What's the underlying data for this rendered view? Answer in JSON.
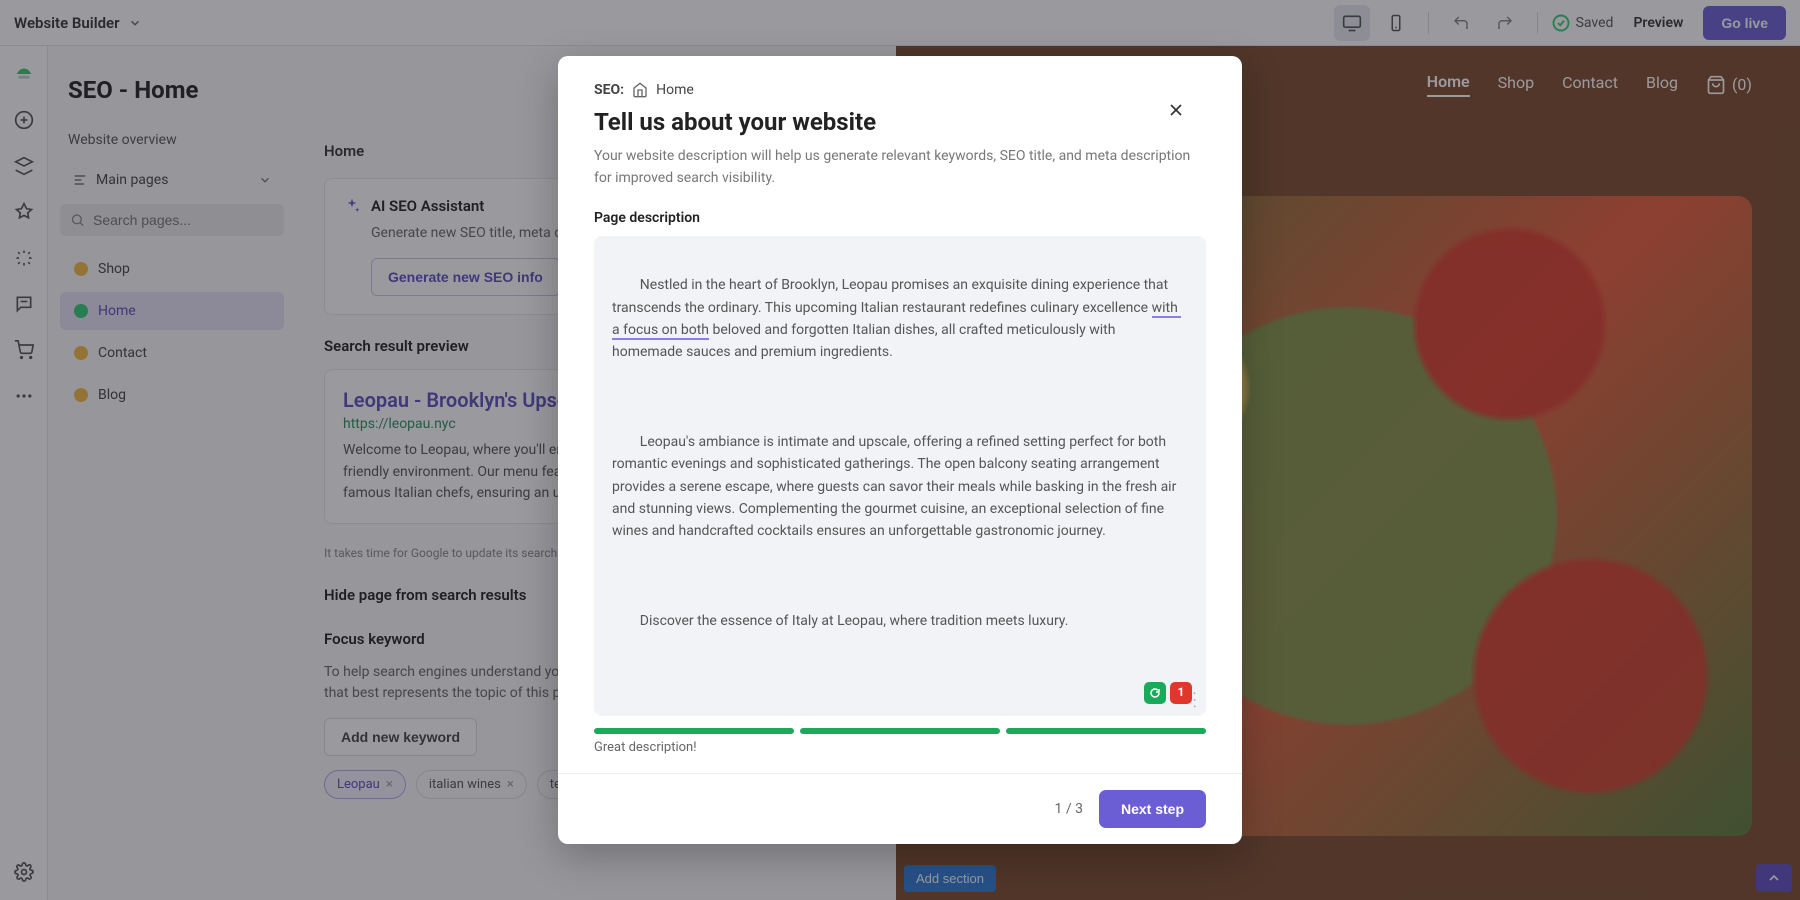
{
  "topbar": {
    "app_name": "Website Builder",
    "saved_label": "Saved",
    "preview_label": "Preview",
    "golive_label": "Go live"
  },
  "panel": {
    "title": "SEO - Home",
    "overview_label": "Website overview",
    "main_pages_label": "Main pages",
    "search_placeholder": "Search pages...",
    "pages": [
      {
        "label": "Shop",
        "status": "yellow"
      },
      {
        "label": "Home",
        "status": "green"
      },
      {
        "label": "Contact",
        "status": "yellow"
      },
      {
        "label": "Blog",
        "status": "yellow"
      }
    ],
    "content": {
      "breadcrumb": "Home",
      "ai_title": "AI SEO Assistant",
      "ai_desc": "Generate new SEO title, meta description and focus keywords for this page",
      "generate_label": "Generate new SEO info",
      "serp_section": "Search result preview",
      "serp_title": "Leopau - Brooklyn's Upscale Italian Restaurant",
      "serp_url": "https://leopau.nyc",
      "serp_desc": "Welcome to Leopau, where you'll enjoy authentic Italian cuisine in a warm and friendly environment. Our menu features traditional dishes and recipes from famous Italian chefs, ensuring an unforgettable culinary experience like no other.",
      "serp_hint": "It takes time for Google to update its search results",
      "hide_section": "Hide page from search results",
      "focus_section": "Focus keyword",
      "focus_help": "To help search engines understand your page content, enter a keyword or keyphrase that best represents the topic of this page",
      "add_keyword_label": "Add new keyword",
      "keywords": [
        {
          "label": "Leopau",
          "primary": true
        },
        {
          "label": "italian wines",
          "primary": false
        },
        {
          "label": "terrace dining",
          "primary": false
        }
      ]
    }
  },
  "site": {
    "nav": [
      "Home",
      "Shop",
      "Contact",
      "Blog"
    ],
    "cart_count": "(0)",
    "add_section": "Add section"
  },
  "modal": {
    "crumb_prefix": "SEO:",
    "crumb_page": "Home",
    "title": "Tell us about your website",
    "subtitle": "Your website description will help us generate relevant keywords, SEO title, and meta description for improved search visibility.",
    "field_label": "Page description",
    "description_p1a": "Nestled in the heart of Brooklyn, Leopau promises an exquisite dining experience that transcends the ordinary. This upcoming Italian restaurant redefines culinary excellence ",
    "description_underlined": "with a focus on both",
    "description_p1b": " beloved and forgotten Italian dishes, all crafted meticulously with homemade sauces and premium ingredients.",
    "description_p2": "Leopau's ambiance is intimate and upscale, offering a refined setting perfect for both romantic evenings and sophisticated gatherings. The open balcony seating arrangement provides a serene escape, where guests can savor their meals while basking in the fresh air and stunning views. Complementing the gourmet cuisine, an exceptional selection of fine wines and handcrafted cocktails ensures an unforgettable gastronomic journey.",
    "description_p3": "Discover the essence of Italy at Leopau, where tradition meets luxury.",
    "badge_error_count": "1",
    "strength_label": "Great description!",
    "step_indicator": "1 / 3",
    "next_label": "Next step"
  }
}
